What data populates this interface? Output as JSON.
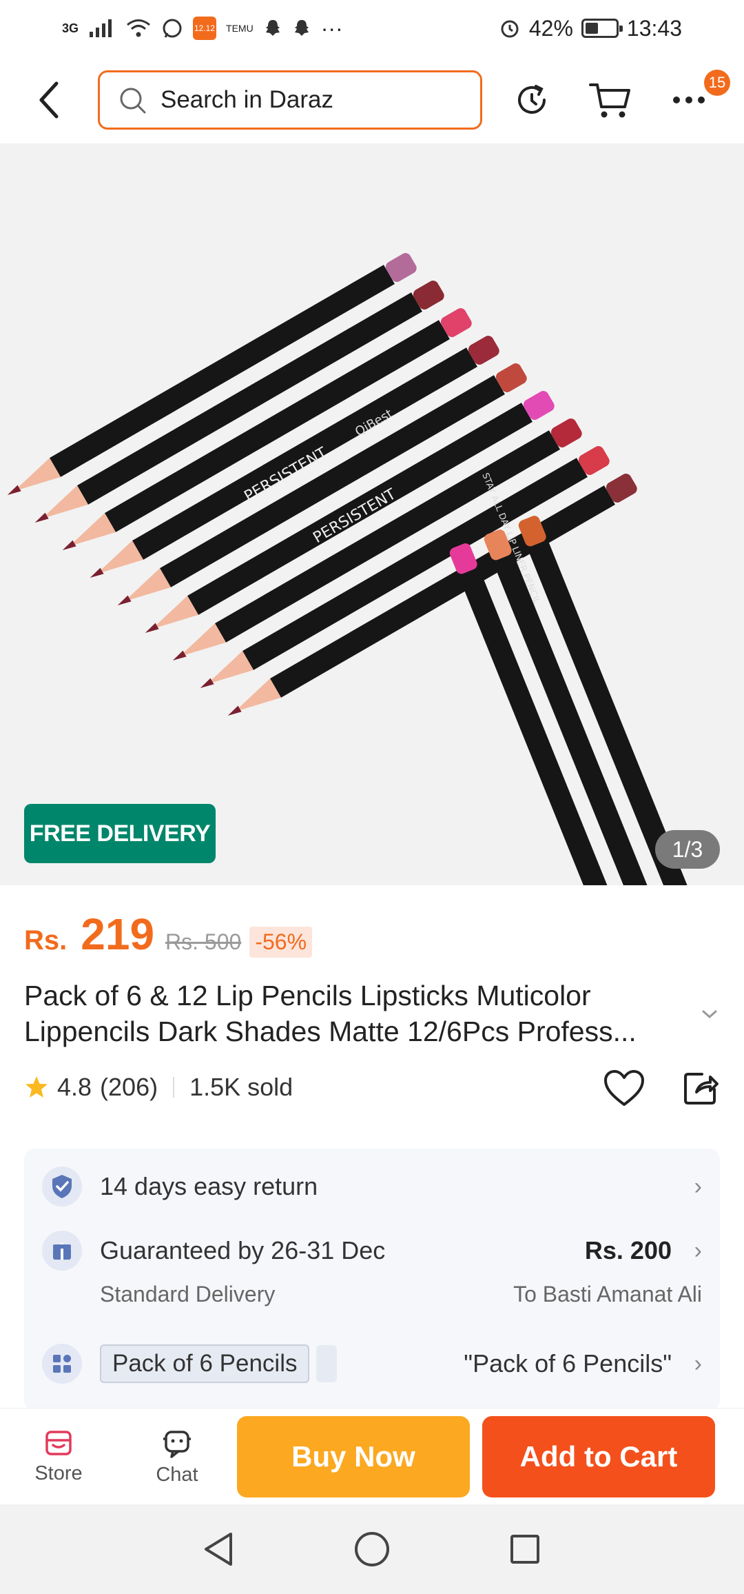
{
  "status_bar": {
    "network": "3G",
    "app_badge": "12.12",
    "app_name": "TEMU",
    "battery": "42%",
    "battery_level": 0.42,
    "time": "13:43"
  },
  "header": {
    "search_placeholder": "Search in Daraz",
    "notification_count": "15"
  },
  "gallery": {
    "free_delivery": "FREE DELIVERY",
    "page_indicator": "1/3",
    "brand_print": "QiBest",
    "pencil_print": "PERSISTENT",
    "pencil_print_alt": "STAY ALL DAY LIP LINER PENCIL"
  },
  "product": {
    "currency": "Rs.",
    "price": "219",
    "old_price": "Rs. 500",
    "discount": "-56%",
    "title_line1": "Pack of 6 & 12 Lip Pencils Lipsticks Muticolor",
    "title_line2": "Lippencils Dark Shades Matte 12/6Pcs Profess...",
    "rating": "4.8",
    "rating_count": "(206)",
    "sold": "1.5K sold"
  },
  "info": {
    "return": "14 days easy return",
    "delivery_title": "Guaranteed by 26-31 Dec",
    "delivery_price": "Rs. 200",
    "delivery_sub": "Standard Delivery",
    "delivery_to": "To Basti Amanat Ali",
    "variant_chip": "Pack of 6 Pencils",
    "variant_selected": "\"Pack of 6 Pencils\""
  },
  "bottom_bar": {
    "store": "Store",
    "chat": "Chat",
    "buy_now": "Buy Now",
    "add_to_cart": "Add to Cart"
  },
  "colors": {
    "brand_orange": "#f26b1d",
    "free_delivery_green": "#00866b",
    "buy_now": "#fca820",
    "add_to_cart": "#f4501b"
  }
}
